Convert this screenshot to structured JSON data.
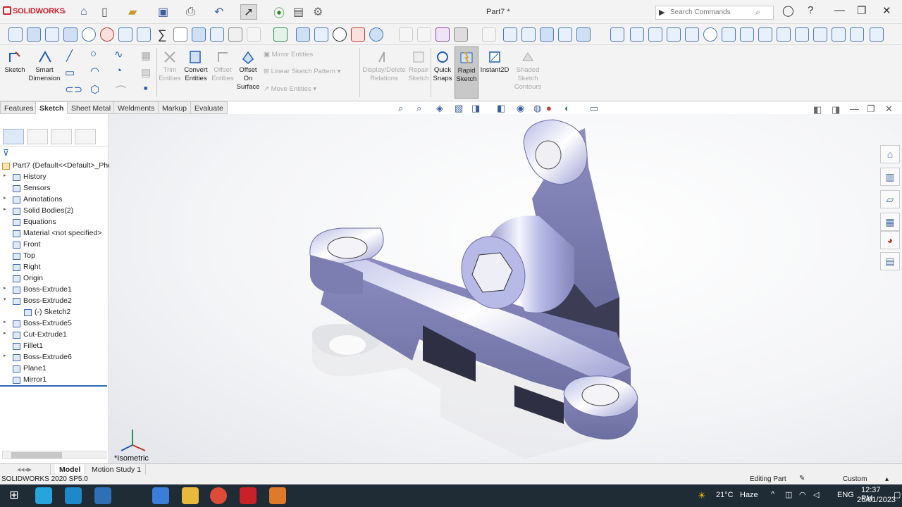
{
  "app": {
    "brand": "SOLIDWORKS",
    "doc_title": "Part7 *",
    "accent": "#d4202a"
  },
  "search": {
    "placeholder": "Search Commands"
  },
  "command_manager": {
    "buttons": [
      {
        "id": "sketch",
        "label": "Sketch",
        "enabled": true
      },
      {
        "id": "smart-dimension",
        "label": "Smart\nDimension",
        "enabled": true
      },
      {
        "id": "trim-entities",
        "label": "Trim\nEntities",
        "enabled": false
      },
      {
        "id": "convert-entities",
        "label": "Convert\nEntities",
        "enabled": true
      },
      {
        "id": "offset-entities",
        "label": "Offset\nEntities",
        "enabled": false
      },
      {
        "id": "offset-on-surface",
        "label": "Offset\nOn\nSurface",
        "enabled": true
      },
      {
        "id": "mirror-entities",
        "label": "Mirror Entities",
        "enabled": false
      },
      {
        "id": "linear-sketch-pattern",
        "label": "Linear Sketch Pattern",
        "enabled": false
      },
      {
        "id": "move-entities",
        "label": "Move Entities",
        "enabled": false
      },
      {
        "id": "display-delete-relations",
        "label": "Display/Delete\nRelations",
        "enabled": false
      },
      {
        "id": "repair-sketch",
        "label": "Repair\nSketch",
        "enabled": false
      },
      {
        "id": "quick-snaps",
        "label": "Quick\nSnaps",
        "enabled": true
      },
      {
        "id": "rapid-sketch",
        "label": "Rapid\nSketch",
        "enabled": true,
        "active": true
      },
      {
        "id": "instant2d",
        "label": "Instant2D",
        "enabled": true
      },
      {
        "id": "shaded-sketch-contours",
        "label": "Shaded\nSketch\nContours",
        "enabled": false
      }
    ]
  },
  "tabs": [
    "Features",
    "Sketch",
    "Sheet Metal",
    "Weldments",
    "Markup",
    "Evaluate"
  ],
  "active_tab": "Sketch",
  "feature_tree": {
    "root": "Part7  (Default<<Default>_Pho",
    "items": [
      {
        "label": "History",
        "expander": true
      },
      {
        "label": "Sensors",
        "expander": false
      },
      {
        "label": "Annotations",
        "expander": true
      },
      {
        "label": "Solid Bodies(2)",
        "expander": true
      },
      {
        "label": "Equations",
        "expander": false
      },
      {
        "label": "Material <not specified>",
        "expander": false
      },
      {
        "label": "Front",
        "expander": false
      },
      {
        "label": "Top",
        "expander": false
      },
      {
        "label": "Right",
        "expander": false
      },
      {
        "label": "Origin",
        "expander": false
      },
      {
        "label": "Boss-Extrude1",
        "expander": true
      },
      {
        "label": "Boss-Extrude2",
        "expander": true,
        "expanded": true
      },
      {
        "label": "(-) Sketch2",
        "expander": false,
        "child": true
      },
      {
        "label": "Boss-Extrude5",
        "expander": true
      },
      {
        "label": "Cut-Extrude1",
        "expander": true
      },
      {
        "label": "Fillet1",
        "expander": false
      },
      {
        "label": "Boss-Extrude6",
        "expander": true
      },
      {
        "label": "Plane1",
        "expander": false
      },
      {
        "label": "Mirror1",
        "expander": false
      }
    ]
  },
  "viewport": {
    "view_label": "*Isometric",
    "part_color": "#9a9ccf"
  },
  "model_tabs": [
    "Model",
    "Motion Study 1"
  ],
  "status": {
    "version": "SOLIDWORKS 2020 SP5.0",
    "mode": "Editing Part",
    "units": "Custom"
  },
  "taskbar": {
    "weather_temp": "21°C",
    "weather_text": "Haze",
    "lang": "ENG",
    "time": "12:37 PM",
    "date": "25/01/2023"
  }
}
